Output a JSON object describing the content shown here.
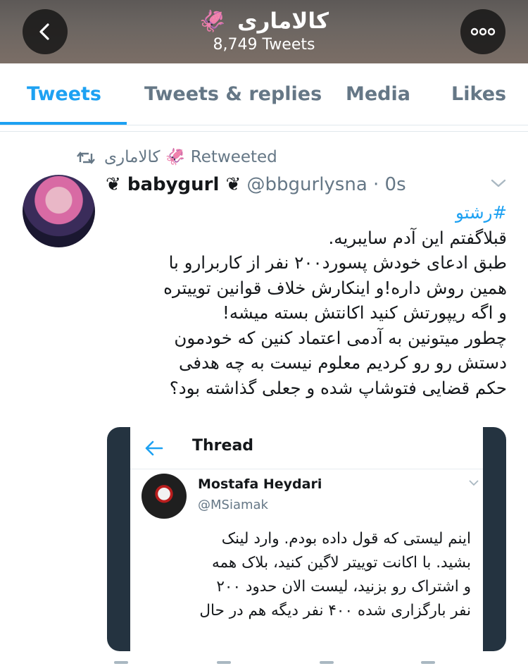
{
  "header": {
    "title": "کالاماری",
    "title_emoji": "🦑",
    "tweet_count": "8,749 Tweets",
    "back_icon": "chevron-left-icon",
    "more_icon": "more-dots-icon"
  },
  "tabs": [
    {
      "label": "Tweets",
      "active": true
    },
    {
      "label": "Tweets & replies",
      "active": false
    },
    {
      "label": "Media",
      "active": false
    },
    {
      "label": "Likes",
      "active": false
    }
  ],
  "tweet": {
    "retweet_by": "کالاماری",
    "retweet_emoji": "🦑",
    "retweet_label": "Retweeted",
    "display_name": "❦ babygurl ❦",
    "handle_time": "@bbgurlysna · 0s",
    "hashtag": "#رشتو",
    "lines": [
      "قبلاگفتم این آدم سایبریه.",
      "طبق ادعای خودش پسورد۲۰۰ نفر از کاربرارو با",
      "همین روش داره!و اینکارش خلاف قوانین توییتره",
      "و اگه ریپورتش کنید اکانتش بسته میشه!",
      "چطور میتونین به آدمی اعتماد کنین که خودمون",
      "دستش رو رو کردیم معلوم نیست به چه هدفی",
      "حکم قضایی فتوشاپ شده و جعلی گذاشته بود؟"
    ]
  },
  "embed": {
    "thread_title": "Thread",
    "author_name": "Mostafa Heydari",
    "author_handle": "@MSiamak",
    "lines": [
      "اینم لیستی که قول داده بودم. وارد لینک",
      "بشید. با اکانت توییتر لاگین کنید، بلاک همه",
      "و اشتراک رو بزنید، لیست الان حدود ۲۰۰",
      "نفر بارگزاری شده ۴۰۰ نفر دیگه هم در حال"
    ]
  },
  "colors": {
    "accent": "#1da1f2",
    "muted": "#657786",
    "text": "#14171a"
  }
}
